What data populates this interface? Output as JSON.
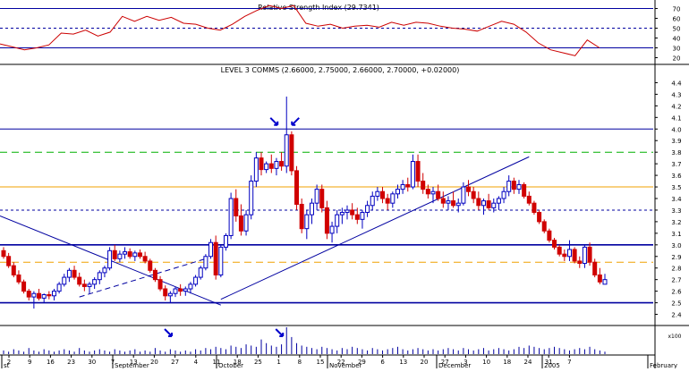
{
  "chart_data": [
    {
      "type": "line",
      "title": "Relative Strength Index (29.7341)",
      "x_range": [
        "2004-08-30",
        "2005-02-01"
      ],
      "y_ticks": [
        20,
        30,
        40,
        50,
        60,
        70
      ],
      "ylim": [
        15,
        75
      ],
      "reference_lines": [
        {
          "y": 70,
          "style": "solid",
          "color": "#0000a0"
        },
        {
          "y": 50,
          "style": "dashed",
          "color": "#0000a0"
        },
        {
          "y": 30,
          "style": "solid",
          "color": "#0000a0"
        }
      ],
      "series": [
        {
          "color": "#cc0000",
          "points": [
            [
              "2004-08-30",
              34
            ],
            [
              "2004-09-06",
              31
            ],
            [
              "2004-09-13",
              28
            ],
            [
              "2004-09-20",
              30
            ],
            [
              "2004-09-27",
              33
            ],
            [
              "2004-10-04",
              45
            ],
            [
              "2004-10-11",
              44
            ],
            [
              "2004-10-18",
              48
            ],
            [
              "2004-10-25",
              42
            ],
            [
              "2004-11-01",
              46
            ],
            [
              "2004-11-08",
              62
            ],
            [
              "2004-11-15",
              57
            ],
            [
              "2004-11-22",
              62
            ],
            [
              "2004-11-29",
              58
            ],
            [
              "2004-12-06",
              61
            ],
            [
              "2004-12-13",
              55
            ],
            [
              "2004-12-20",
              54
            ],
            [
              "2004-12-27",
              50
            ],
            [
              "2005-01-03",
              48
            ],
            [
              "2005-01-10",
              54
            ],
            [
              "2005-01-17",
              62
            ],
            [
              "2005-01-24",
              68
            ],
            [
              "2005-01-31",
              73
            ],
            [
              "2005-02-07",
              70
            ],
            [
              "2005-02-14",
              73
            ],
            [
              "2005-02-21",
              55
            ],
            [
              "2005-02-28",
              52
            ],
            [
              "2005-03-07",
              54
            ],
            [
              "2005-03-14",
              50
            ],
            [
              "2005-03-21",
              52
            ],
            [
              "2005-03-28",
              53
            ],
            [
              "2005-04-04",
              51
            ],
            [
              "2005-04-11",
              56
            ],
            [
              "2005-04-18",
              53
            ],
            [
              "2005-04-25",
              56
            ],
            [
              "2005-05-02",
              55
            ],
            [
              "2005-05-09",
              52
            ],
            [
              "2005-05-16",
              50
            ],
            [
              "2005-05-23",
              49
            ],
            [
              "2005-05-30",
              47
            ],
            [
              "2005-06-06",
              52
            ],
            [
              "2005-06-13",
              57
            ],
            [
              "2005-06-20",
              54
            ],
            [
              "2005-06-27",
              46
            ],
            [
              "2005-07-04",
              35
            ],
            [
              "2005-07-11",
              28
            ],
            [
              "2005-07-18",
              25
            ],
            [
              "2005-07-25",
              22
            ],
            [
              "2005-08-01",
              38
            ],
            [
              "2005-08-08",
              30
            ]
          ]
        }
      ],
      "note_on_points": "RSI points are indexed by plot position; x positions are mapped linearly across the shared date axis by the script."
    },
    {
      "type": "candlestick",
      "title": "LEVEL 3 COMMS (2.66000, 2.75000, 2.66000, 2.70000, +0.02000)",
      "ylim": [
        2.35,
        4.45
      ],
      "y_ticks": [
        2.4,
        2.5,
        2.6,
        2.7,
        2.8,
        2.9,
        3.0,
        3.1,
        3.2,
        3.3,
        3.4,
        3.5,
        3.6,
        3.7,
        3.8,
        3.9,
        4.0,
        4.1,
        4.2,
        4.3,
        4.4
      ],
      "x_tick_labels": [
        "2",
        "9",
        "16",
        "23",
        "30",
        "7",
        "13",
        "20",
        "27",
        "4",
        "11",
        "18",
        "25",
        "1",
        "8",
        "15",
        "22",
        "29",
        "6",
        "13",
        "20",
        "27",
        "3",
        "10",
        "18",
        "24",
        "31",
        "7"
      ],
      "month_labels": [
        "August",
        "September",
        "October",
        "November",
        "December",
        "2005",
        "February"
      ],
      "horizontal_lines": [
        {
          "y": 4.0,
          "style": "solid",
          "color": "#0000a0"
        },
        {
          "y": 3.8,
          "style": "dashed",
          "color": "#00b000"
        },
        {
          "y": 3.5,
          "style": "solid",
          "color": "#f0a000"
        },
        {
          "y": 3.3,
          "style": "dotted",
          "color": "#0000a0"
        },
        {
          "y": 3.0,
          "style": "solid",
          "color": "#0000a0"
        },
        {
          "y": 2.85,
          "style": "dashed",
          "color": "#f0a000"
        },
        {
          "y": 2.5,
          "style": "solid",
          "color": "#0000a0"
        }
      ],
      "candles": [
        [
          2.95,
          2.98,
          2.88,
          2.9
        ],
        [
          2.9,
          2.93,
          2.8,
          2.82
        ],
        [
          2.82,
          2.85,
          2.72,
          2.74
        ],
        [
          2.74,
          2.78,
          2.66,
          2.68
        ],
        [
          2.68,
          2.7,
          2.58,
          2.6
        ],
        [
          2.6,
          2.62,
          2.52,
          2.55
        ],
        [
          2.55,
          2.6,
          2.45,
          2.58
        ],
        [
          2.58,
          2.62,
          2.52,
          2.54
        ],
        [
          2.54,
          2.58,
          2.5,
          2.57
        ],
        [
          2.57,
          2.6,
          2.53,
          2.56
        ],
        [
          2.56,
          2.62,
          2.52,
          2.6
        ],
        [
          2.6,
          2.68,
          2.58,
          2.66
        ],
        [
          2.66,
          2.75,
          2.64,
          2.72
        ],
        [
          2.72,
          2.8,
          2.68,
          2.78
        ],
        [
          2.78,
          2.82,
          2.7,
          2.72
        ],
        [
          2.72,
          2.76,
          2.64,
          2.66
        ],
        [
          2.66,
          2.7,
          2.6,
          2.64
        ],
        [
          2.64,
          2.68,
          2.58,
          2.66
        ],
        [
          2.66,
          2.72,
          2.62,
          2.7
        ],
        [
          2.7,
          2.78,
          2.66,
          2.76
        ],
        [
          2.76,
          2.82,
          2.72,
          2.8
        ],
        [
          2.8,
          2.98,
          2.78,
          2.95
        ],
        [
          2.95,
          3.0,
          2.86,
          2.88
        ],
        [
          2.88,
          2.95,
          2.85,
          2.92
        ],
        [
          2.92,
          2.98,
          2.88,
          2.94
        ],
        [
          2.94,
          2.97,
          2.88,
          2.9
        ],
        [
          2.9,
          2.95,
          2.86,
          2.93
        ],
        [
          2.93,
          2.96,
          2.88,
          2.9
        ],
        [
          2.9,
          2.94,
          2.84,
          2.86
        ],
        [
          2.86,
          2.88,
          2.76,
          2.78
        ],
        [
          2.78,
          2.8,
          2.68,
          2.7
        ],
        [
          2.7,
          2.73,
          2.6,
          2.62
        ],
        [
          2.62,
          2.65,
          2.52,
          2.56
        ],
        [
          2.56,
          2.6,
          2.5,
          2.58
        ],
        [
          2.58,
          2.64,
          2.55,
          2.62
        ],
        [
          2.62,
          2.66,
          2.56,
          2.6
        ],
        [
          2.6,
          2.64,
          2.56,
          2.62
        ],
        [
          2.62,
          2.68,
          2.58,
          2.66
        ],
        [
          2.66,
          2.74,
          2.64,
          2.72
        ],
        [
          2.72,
          2.82,
          2.7,
          2.8
        ],
        [
          2.8,
          2.92,
          2.78,
          2.9
        ],
        [
          2.9,
          3.05,
          2.88,
          3.02
        ],
        [
          3.02,
          3.08,
          2.7,
          2.74
        ],
        [
          2.74,
          3.0,
          2.72,
          2.98
        ],
        [
          2.98,
          3.1,
          2.95,
          3.08
        ],
        [
          3.08,
          3.45,
          3.05,
          3.4
        ],
        [
          3.4,
          3.48,
          3.2,
          3.25
        ],
        [
          3.25,
          3.35,
          3.08,
          3.12
        ],
        [
          3.12,
          3.3,
          3.08,
          3.26
        ],
        [
          3.26,
          3.6,
          3.22,
          3.55
        ],
        [
          3.55,
          3.8,
          3.5,
          3.75
        ],
        [
          3.75,
          3.8,
          3.6,
          3.65
        ],
        [
          3.65,
          3.72,
          3.62,
          3.7
        ],
        [
          3.7,
          3.78,
          3.62,
          3.66
        ],
        [
          3.66,
          3.75,
          3.6,
          3.72
        ],
        [
          3.72,
          3.8,
          3.64,
          3.68
        ],
        [
          3.68,
          4.28,
          3.62,
          3.95
        ],
        [
          3.95,
          3.98,
          3.6,
          3.64
        ],
        [
          3.64,
          3.68,
          3.3,
          3.35
        ],
        [
          3.35,
          3.4,
          3.1,
          3.14
        ],
        [
          3.14,
          3.3,
          3.05,
          3.26
        ],
        [
          3.26,
          3.4,
          3.18,
          3.36
        ],
        [
          3.36,
          3.52,
          3.3,
          3.48
        ],
        [
          3.48,
          3.52,
          3.28,
          3.32
        ],
        [
          3.32,
          3.38,
          3.05,
          3.1
        ],
        [
          3.1,
          3.2,
          3.02,
          3.16
        ],
        [
          3.16,
          3.3,
          3.1,
          3.26
        ],
        [
          3.26,
          3.32,
          3.18,
          3.28
        ],
        [
          3.28,
          3.34,
          3.22,
          3.3
        ],
        [
          3.3,
          3.36,
          3.22,
          3.26
        ],
        [
          3.26,
          3.32,
          3.18,
          3.22
        ],
        [
          3.22,
          3.3,
          3.14,
          3.28
        ],
        [
          3.28,
          3.38,
          3.24,
          3.34
        ],
        [
          3.34,
          3.46,
          3.3,
          3.42
        ],
        [
          3.42,
          3.5,
          3.38,
          3.46
        ],
        [
          3.46,
          3.5,
          3.36,
          3.4
        ],
        [
          3.4,
          3.44,
          3.3,
          3.36
        ],
        [
          3.36,
          3.46,
          3.32,
          3.44
        ],
        [
          3.44,
          3.52,
          3.4,
          3.48
        ],
        [
          3.48,
          3.56,
          3.44,
          3.52
        ],
        [
          3.52,
          3.58,
          3.46,
          3.5
        ],
        [
          3.5,
          3.78,
          3.48,
          3.72
        ],
        [
          3.72,
          3.78,
          3.5,
          3.55
        ],
        [
          3.55,
          3.62,
          3.44,
          3.48
        ],
        [
          3.48,
          3.52,
          3.4,
          3.44
        ],
        [
          3.44,
          3.5,
          3.36,
          3.46
        ],
        [
          3.46,
          3.52,
          3.38,
          3.4
        ],
        [
          3.4,
          3.46,
          3.32,
          3.36
        ],
        [
          3.36,
          3.42,
          3.3,
          3.38
        ],
        [
          3.38,
          3.46,
          3.32,
          3.34
        ],
        [
          3.34,
          3.4,
          3.28,
          3.36
        ],
        [
          3.36,
          3.54,
          3.34,
          3.5
        ],
        [
          3.5,
          3.56,
          3.42,
          3.46
        ],
        [
          3.46,
          3.5,
          3.36,
          3.4
        ],
        [
          3.4,
          3.46,
          3.3,
          3.34
        ],
        [
          3.34,
          3.4,
          3.26,
          3.38
        ],
        [
          3.38,
          3.44,
          3.3,
          3.32
        ],
        [
          3.32,
          3.4,
          3.28,
          3.36
        ],
        [
          3.36,
          3.42,
          3.3,
          3.4
        ],
        [
          3.4,
          3.5,
          3.36,
          3.46
        ],
        [
          3.46,
          3.6,
          3.42,
          3.55
        ],
        [
          3.55,
          3.58,
          3.44,
          3.48
        ],
        [
          3.48,
          3.56,
          3.44,
          3.52
        ],
        [
          3.52,
          3.54,
          3.4,
          3.42
        ],
        [
          3.42,
          3.46,
          3.34,
          3.36
        ],
        [
          3.36,
          3.38,
          3.26,
          3.28
        ],
        [
          3.28,
          3.3,
          3.18,
          3.2
        ],
        [
          3.2,
          3.22,
          3.1,
          3.12
        ],
        [
          3.12,
          3.14,
          3.02,
          3.04
        ],
        [
          3.04,
          3.06,
          2.96,
          2.98
        ],
        [
          2.98,
          3.0,
          2.9,
          2.92
        ],
        [
          2.92,
          2.96,
          2.86,
          2.9
        ],
        [
          2.9,
          3.04,
          2.86,
          2.96
        ],
        [
          2.96,
          2.98,
          2.84,
          2.86
        ],
        [
          2.86,
          2.9,
          2.8,
          2.84
        ],
        [
          2.84,
          3.0,
          2.8,
          2.98
        ],
        [
          2.98,
          3.02,
          2.82,
          2.85
        ],
        [
          2.85,
          2.88,
          2.72,
          2.74
        ],
        [
          2.74,
          2.8,
          2.66,
          2.68
        ],
        [
          2.66,
          2.75,
          2.66,
          2.7
        ]
      ],
      "trendlines": [
        {
          "from": [
            0,
            3.25
          ],
          "to": [
            43,
            2.48
          ],
          "color": "#0000a0"
        },
        {
          "from": [
            43,
            2.53
          ],
          "to": [
            104,
            3.76
          ],
          "color": "#0000a0"
        },
        {
          "from": [
            15,
            2.55
          ],
          "to": [
            40,
            2.88
          ],
          "color": "#0000a0",
          "dashed": true
        }
      ],
      "annotations": [
        {
          "type": "arrow",
          "candle": 56,
          "side": "left",
          "y": 4.05,
          "color": "#0000cc"
        },
        {
          "type": "arrow",
          "candle": 56,
          "side": "right",
          "y": 4.05,
          "color": "#0000cc"
        }
      ]
    },
    {
      "type": "bar",
      "title": "",
      "ylabel": "x100",
      "volume": [
        3,
        2,
        4,
        3,
        2,
        5,
        3,
        2,
        4,
        3,
        2,
        3,
        4,
        3,
        2,
        5,
        3,
        2,
        3,
        4,
        3,
        2,
        4,
        3,
        2,
        3,
        4,
        2,
        3,
        2,
        5,
        3,
        2,
        4,
        3,
        2,
        3,
        2,
        4,
        3,
        5,
        4,
        6,
        5,
        4,
        7,
        6,
        5,
        8,
        7,
        6,
        12,
        9,
        7,
        6,
        8,
        22,
        14,
        9,
        7,
        6,
        5,
        4,
        6,
        5,
        4,
        3,
        5,
        4,
        6,
        5,
        4,
        3,
        5,
        4,
        3,
        4,
        5,
        6,
        4,
        3,
        4,
        5,
        4,
        3,
        4,
        3,
        4,
        5,
        4,
        3,
        5,
        4,
        3,
        4,
        5,
        3,
        4,
        5,
        4,
        3,
        4,
        6,
        5,
        7,
        6,
        5,
        4,
        5,
        6,
        5,
        4,
        3,
        4,
        5,
        4,
        6,
        4,
        3,
        2
      ],
      "arrows_at_candles": [
        34,
        56
      ]
    }
  ],
  "labels": {
    "rsi_title": "Relative Strength Index (29.7341)",
    "price_title": "LEVEL 3 COMMS (2.66000, 2.75000, 2.66000, 2.70000, +0.02000)",
    "volume_unit": "x100"
  }
}
